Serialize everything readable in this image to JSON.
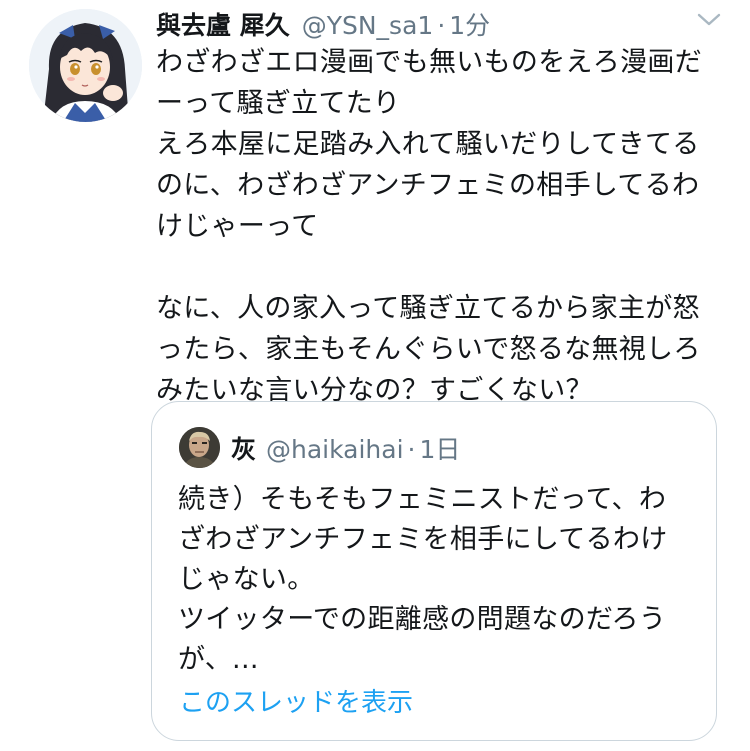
{
  "tweet": {
    "author": {
      "display_name": "與去盧 犀久",
      "handle": "@YSN_sa1",
      "avatar_icon": "anime-girl-avatar"
    },
    "separator": "·",
    "time": "1分",
    "text_lines": [
      "わざわざエロ漫画でも無いものをえろ漫画だ",
      "ーって騒ぎ立てたり",
      "えろ本屋に足踏み入れて騒いだりしてきてる",
      "のに、わざわざアンチフェミの相手してるわ",
      "けじゃーって",
      "",
      "なに、人の家入って騒ぎ立てるから家主が怒",
      "ったら、家主もそんぐらいで怒るな無視しろ",
      "みたいな言い分なの？すごくない？"
    ],
    "menu_icon": "chevron-down-icon"
  },
  "quoted": {
    "author": {
      "display_name": "灰",
      "handle": "@haikaihai",
      "avatar_icon": "man-portrait-avatar"
    },
    "separator": "·",
    "time": "1日",
    "text_lines": [
      "続き）そもそもフェミニストだって、わ",
      "ざわざアンチフェミを相手にしてるわけ",
      "じゃない。",
      "ツイッターでの距離感の問題なのだろう",
      "が、..."
    ],
    "show_thread_label": "このスレッドを表示"
  },
  "colors": {
    "text": "#14171a",
    "secondary": "#657786",
    "link": "#1da1f2",
    "border": "#ccd6dd"
  }
}
